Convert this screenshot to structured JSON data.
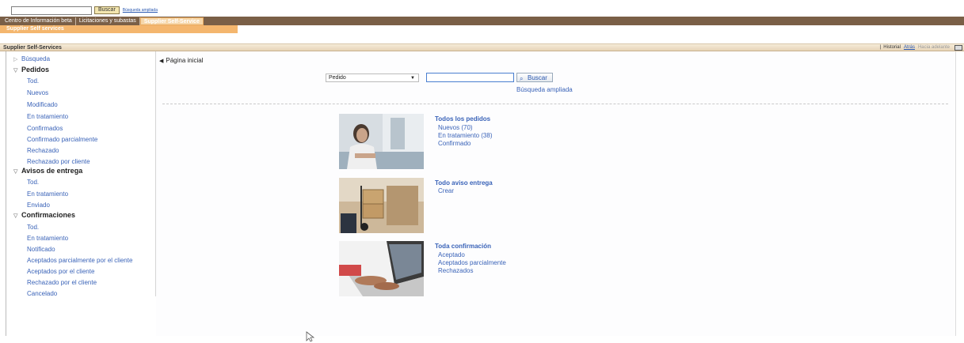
{
  "top_search": {
    "button_label": "Buscar",
    "advanced_link": "Búsqueda ampliada"
  },
  "tabs": [
    {
      "label": "Centro de Información beta"
    },
    {
      "label": "Licitaciones y subastas"
    },
    {
      "label": "Supplier Self-Service"
    }
  ],
  "subtab": {
    "label": "Supplier Self services"
  },
  "header": {
    "title": "Supplier Self-Services",
    "history": "Historial",
    "back": "Atrás",
    "forward": "Hacia adelante"
  },
  "sidebar": {
    "busqueda": "Búsqueda",
    "pedidos": {
      "title": "Pedidos",
      "items": [
        "Tod.",
        "Nuevos",
        "Modificado",
        "En tratamiento",
        "Confirmados",
        "Confirmado parcialmente",
        "Rechazado",
        "Rechazado por cliente"
      ]
    },
    "avisos": {
      "title": "Avisos de entrega",
      "items": [
        "Tod.",
        "En tratamiento",
        "Enviado"
      ]
    },
    "confirmaciones": {
      "title": "Confirmaciones",
      "items": [
        "Tod.",
        "En tratamiento",
        "Notificado",
        "Aceptados parcialmente por el cliente",
        "Aceptados por el cliente",
        "Rechazado por el cliente",
        "Cancelado"
      ]
    }
  },
  "main": {
    "page_title": "Página inicial",
    "select_value": "Pedido",
    "search_button": "Buscar",
    "advanced_link": "Búsqueda ampliada",
    "cards": [
      {
        "title": "Todos los pedidos",
        "links": [
          "Nuevos (70)",
          "En tratamiento (38)",
          "Confirmado"
        ]
      },
      {
        "title": "Todo aviso entrega",
        "links": [
          "Crear"
        ]
      },
      {
        "title": "Toda confirmación",
        "links": [
          "Aceptado",
          "Aceptados parcialmente",
          "Rechazados"
        ]
      }
    ]
  },
  "colors": {
    "tabbar": "#7a5f47",
    "accent": "#f4b66e",
    "link": "#3a63b8"
  }
}
